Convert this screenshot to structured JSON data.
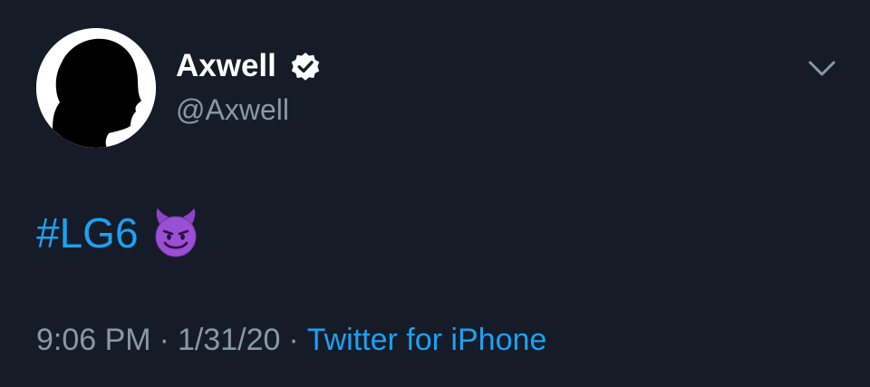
{
  "tweet": {
    "author": {
      "display_name": "Axwell",
      "handle": "@Axwell",
      "verified": true,
      "avatar_icon": "silhouette-profile-avatar"
    },
    "text": {
      "hashtag": "#LG6",
      "emoji_name": "smiling-face-with-horns-emoji"
    },
    "meta": {
      "time": "9:06 PM",
      "separator": "·",
      "date": "1/31/20",
      "source": "Twitter for iPhone"
    },
    "icons": {
      "verified": "verified-badge-icon",
      "menu": "chevron-down-icon"
    }
  },
  "colors": {
    "background": "#151c28",
    "primary_text": "#ffffff",
    "secondary_text": "#8899a6",
    "accent": "#1da1f2",
    "emoji_purple": "#8e44c9"
  }
}
